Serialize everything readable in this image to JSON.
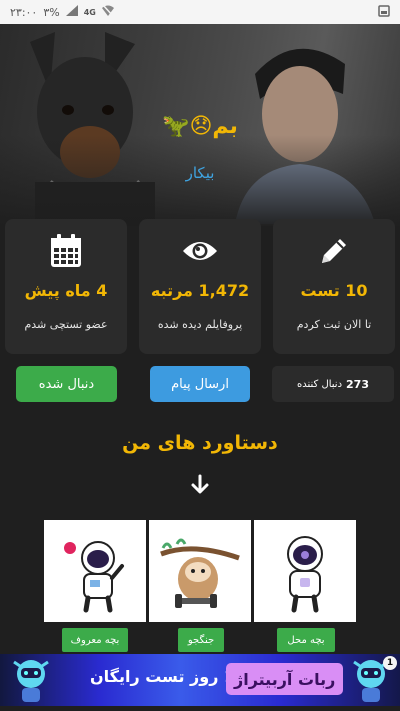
{
  "status_bar": {
    "time": "۲۳:۰۰",
    "battery": "۳%",
    "network": "4G"
  },
  "profile": {
    "username": "بم😞🦖",
    "bio": "بیکار"
  },
  "stats": [
    {
      "icon": "calendar-icon",
      "value": "4 ماه پیش",
      "label": "عضو تستچی شدم"
    },
    {
      "icon": "eye-icon",
      "value": "1,472 مرتبه",
      "label": "پروفایلم دیده شده"
    },
    {
      "icon": "pencil-icon",
      "value": "10 تست",
      "label": "تا الان ثبت کردم"
    }
  ],
  "actions": {
    "follow_label": "دنبال شده",
    "message_label": "ارسال پیام",
    "followers_count": "273",
    "followers_label": "دنبال کننده"
  },
  "achievements": {
    "title": "دستاورد های من",
    "badges": [
      {
        "icon": "astronaut-heart-icon",
        "label": "بچه معروف"
      },
      {
        "icon": "sloth-icon",
        "label": "جنگجو"
      },
      {
        "icon": "astronaut-thumbs-icon",
        "label": "بچه محل"
      }
    ]
  },
  "ad": {
    "badge_text": "ربات آربیتراژ",
    "text": "15 روز تست رایگان",
    "close_text": "1"
  },
  "colors": {
    "accent": "#f2b705",
    "link": "#3fa3e0",
    "green": "#3cab4a",
    "blue": "#3d9be0",
    "card": "#2b2b2b",
    "background": "#1f1f1f"
  }
}
